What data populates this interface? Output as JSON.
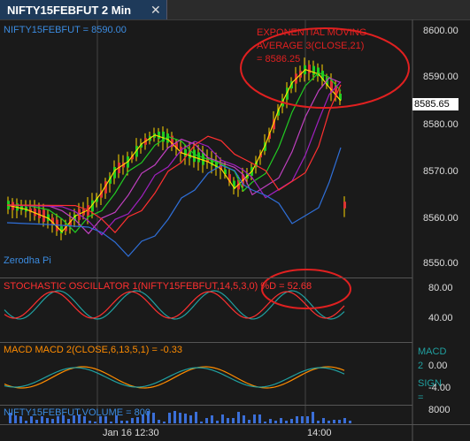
{
  "tab": {
    "title": "NIFTY15FEBFUT 2 Min",
    "close": "✕"
  },
  "panels": {
    "price": {
      "label": "NIFTY15FEBFUT = 8590.00",
      "watermark": "Zerodha Pi",
      "annotation": "EXPONENTIAL MOVING AVERAGE 3(CLOSE,21) = 8586.25",
      "ticks": [
        "8600.00",
        "8590.00",
        "8580.00",
        "8570.00",
        "8560.00",
        "8550.00"
      ],
      "last_price": "8585.65"
    },
    "stochastic": {
      "label": "STOCHASTIC OSCILLATOR 1(NIFTY15FEBFUT,14,5,3,0) %D = 52.68",
      "ticks": [
        "80.00",
        "40.00"
      ]
    },
    "macd": {
      "label": "MACD MACD 2(CLOSE,6,13,5,1) = -0.33",
      "right_label_1": "MACD",
      "right_label_2": "2",
      "right_label_3": "SIGN",
      "right_label_4": "=",
      "ticks": [
        "0.00",
        "-4.00"
      ]
    },
    "volume": {
      "label": "NIFTY15FEBFUT.VOLUME = 800",
      "ticks": [
        "8000"
      ]
    }
  },
  "time_axis": {
    "labels": [
      "Jan 16 12:30",
      "14:00"
    ]
  },
  "colors": {
    "ema_red": "#d42020",
    "up": "#22cc22",
    "down": "#dd3333",
    "wick": "#ffd700",
    "label_blue": "#3b8be0",
    "stoch_red": "#ff3030"
  }
}
